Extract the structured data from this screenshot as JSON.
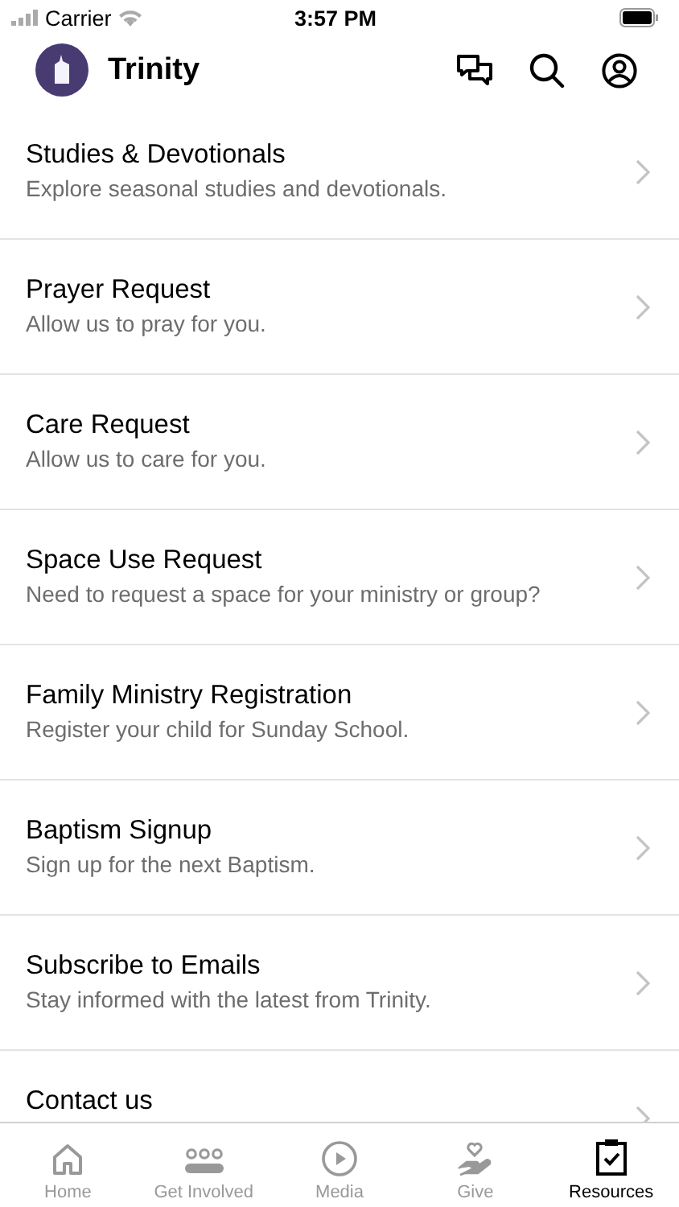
{
  "status_bar": {
    "carrier": "Carrier",
    "time": "3:57 PM"
  },
  "header": {
    "title": "Trinity"
  },
  "items": [
    {
      "title": "Studies & Devotionals",
      "subtitle": "Explore seasonal studies and devotionals."
    },
    {
      "title": "Prayer Request",
      "subtitle": "Allow us to pray for you."
    },
    {
      "title": "Care Request",
      "subtitle": "Allow us to care for you."
    },
    {
      "title": "Space Use Request",
      "subtitle": "Need to request a space for your ministry or group?"
    },
    {
      "title": "Family Ministry Registration",
      "subtitle": "Register your child for Sunday School."
    },
    {
      "title": "Baptism Signup",
      "subtitle": "Sign up for the next Baptism."
    },
    {
      "title": "Subscribe to Emails",
      "subtitle": "Stay informed with the latest from Trinity."
    },
    {
      "title": "Contact us"
    }
  ],
  "tabs": [
    {
      "label": "Home",
      "selected": false
    },
    {
      "label": "Get Involved",
      "selected": false
    },
    {
      "label": "Media",
      "selected": false
    },
    {
      "label": "Give",
      "selected": false
    },
    {
      "label": "Resources",
      "selected": true
    }
  ]
}
